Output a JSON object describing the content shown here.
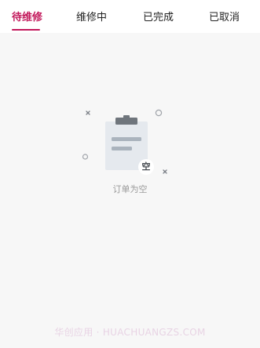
{
  "tabs": [
    {
      "label": "待维修",
      "active": true
    },
    {
      "label": "维修中",
      "active": false
    },
    {
      "label": "已完成",
      "active": false
    },
    {
      "label": "已取消",
      "active": false
    }
  ],
  "empty_state": {
    "icon": "clipboard-empty-icon",
    "badge": "空",
    "message": "订单为空"
  },
  "watermark": "华创应用 · HUACHUANGZS.COM",
  "colors": {
    "accent": "#c2185b",
    "background": "#f7f7f7",
    "muted_text": "#9a9a9a"
  }
}
